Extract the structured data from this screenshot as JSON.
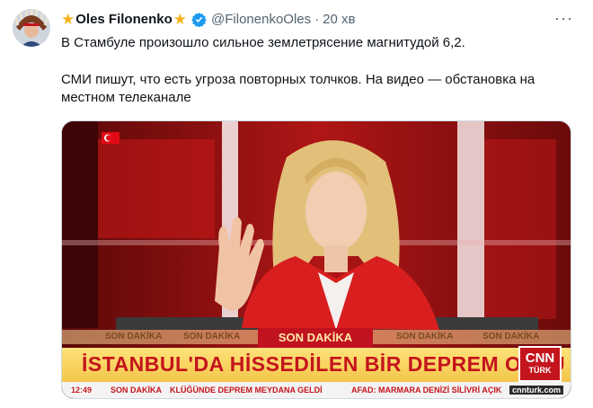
{
  "tweet": {
    "author_name": "Oles Filonenko",
    "handle": "@FilonenkoOles",
    "separator": "·",
    "time": "20 хв",
    "more_label": "···",
    "text_line1": "В Стамбуле произошло сильное землетрясение магнитудой 6,2.",
    "text_line2": "СМИ пишут, что есть угроза повторных толчков. На видео — обстановка на местном телеканале"
  },
  "video": {
    "son_dakika_small": "SON DAKİKA",
    "son_dakika_big": "SON DAKİKA",
    "headline": "İSTANBUL'DA HİSSEDİLEN BİR DEPREM OLDU",
    "channel_logo_top": "CNN",
    "channel_logo_bottom": "TÜRK",
    "ticker_time": "12:49",
    "ticker_son": "SON DAKİKA",
    "ticker_text1": "KLÜĞÜNDE DEPREM MEYDANA GELDİ",
    "ticker_text2": "AFAD: MARMARA DENİZİ SİLİVRİ AÇIK",
    "ticker_site": "cnnturk.com"
  },
  "colors": {
    "accent_red": "#c4141c",
    "gold": "#f5b41c",
    "verified_blue": "#1d9bf0",
    "muted_text": "#536471"
  },
  "icons": [
    "avatar",
    "star-icon",
    "verified-badge-icon",
    "more-options-icon",
    "turkish-flag-icon"
  ]
}
